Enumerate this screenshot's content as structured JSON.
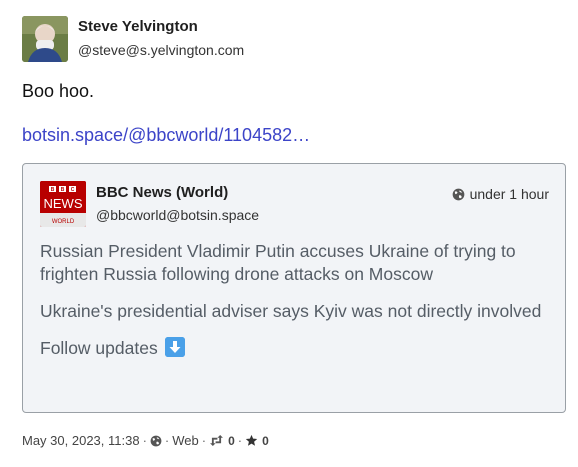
{
  "author": {
    "name": "Steve Yelvington",
    "handle": "@steve@s.yelvington.com"
  },
  "status": {
    "text": "Boo hoo.",
    "link": "botsin.space/@bbcworld/1104582…"
  },
  "quote": {
    "avatar": {
      "top": "BBC",
      "middle": "NEWS",
      "bottom": "WORLD"
    },
    "name": "BBC News (World)",
    "handle": "@bbcworld@botsin.space",
    "time": "under 1 hour",
    "paragraphs": [
      "Russian President Vladimir Putin accuses Ukraine of trying to frighten Russia following drone attacks on Moscow",
      "Ukraine's presidential adviser says Kyiv was not directly involved",
      "Follow updates"
    ]
  },
  "meta": {
    "datetime": "May 30, 2023, 11:38",
    "app": "Web",
    "boosts": "0",
    "favourites": "0"
  },
  "colors": {
    "link": "#3c44c8",
    "bbc_red": "#b50000"
  }
}
